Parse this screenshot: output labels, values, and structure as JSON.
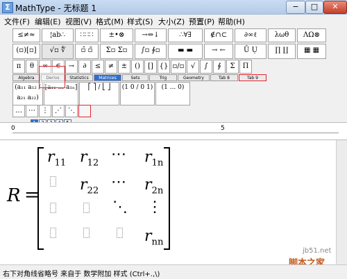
{
  "window": {
    "title": "MathType - 无标题 1",
    "app_icon": "Σ",
    "buttons": {
      "minimize": "−",
      "maximize": "□",
      "close": "✕"
    }
  },
  "menu": [
    "文件(F)",
    "编辑(E)",
    "视图(V)",
    "格式(M)",
    "样式(S)",
    "大小(Z)",
    "预置(P)",
    "帮助(H)"
  ],
  "toolbar": {
    "row1": [
      "≤≠≈",
      "¦ab∴",
      "∷∷∷",
      "±•⊗",
      "→⇔↓",
      "∴∀∃",
      "∉∩⊂",
      "∂∞ℓ",
      "λωθ",
      "ΛΩ⊗"
    ],
    "row2": [
      "(▫)[▫]",
      "√▫ ∜",
      "▫̂ ▫̃",
      "Σ▫ Σ▫",
      "∫▫ ∮▫",
      "▬ ▬",
      "→ ←",
      "Ū Ụ",
      "∏ ∐",
      "▦ ▦"
    ],
    "row3": [
      "π",
      "θ",
      "∞",
      "∈",
      "→",
      "∂",
      "≤",
      "≠",
      "±",
      "()",
      "[]",
      "{}",
      "▫/▫",
      "√",
      "∫",
      "∮",
      "Σ",
      "Π"
    ],
    "tabs": [
      "Algebra",
      "Derivs",
      "Statistics",
      "Matrices",
      "Sets",
      "Trig",
      "Geometry",
      "Tab 8",
      "Tab 9"
    ],
    "active_tab": 3,
    "templates": [
      "(a₁₁ a₁₂ / a₂₁ a₂₂)",
      "[a₁₁ ... a₁ₙ]",
      "⎡ ⎤ / ⎣ ⎦",
      "(1 0 / 0 1)",
      "(1 ... 0)"
    ],
    "ellipsis_buttons": [
      "…",
      "⋯",
      "⋮",
      "⋰",
      "⋱"
    ],
    "pager": [
      "1",
      "2",
      "3",
      "4",
      "5"
    ]
  },
  "ruler": {
    "marks": [
      "0",
      "5"
    ]
  },
  "equation": {
    "lhs": "R",
    "equals": "=",
    "cells": [
      [
        {
          "base": "r",
          "sub": "11"
        },
        {
          "base": "r",
          "sub": "12"
        },
        {
          "base": "⋯",
          "sub": ""
        },
        {
          "base": "r",
          "sub": "1n"
        }
      ],
      [
        {
          "base": "",
          "sub": ""
        },
        {
          "base": "r",
          "sub": "22"
        },
        {
          "base": "⋯",
          "sub": ""
        },
        {
          "base": "r",
          "sub": "2n"
        }
      ],
      [
        {
          "base": "",
          "sub": ""
        },
        {
          "base": "",
          "sub": ""
        },
        {
          "base": "⋱",
          "sub": ""
        },
        {
          "base": "⋮",
          "sub": ""
        }
      ],
      [
        {
          "base": "",
          "sub": ""
        },
        {
          "base": "",
          "sub": ""
        },
        {
          "base": "",
          "sub": ""
        },
        {
          "base": "r",
          "sub": "nn"
        }
      ]
    ]
  },
  "status": "右下对角线省略号 来自于 数学附加 样式 (Ctrl+.,\\)",
  "watermark": {
    "site": "jb51.net",
    "name": "脚本之家"
  }
}
